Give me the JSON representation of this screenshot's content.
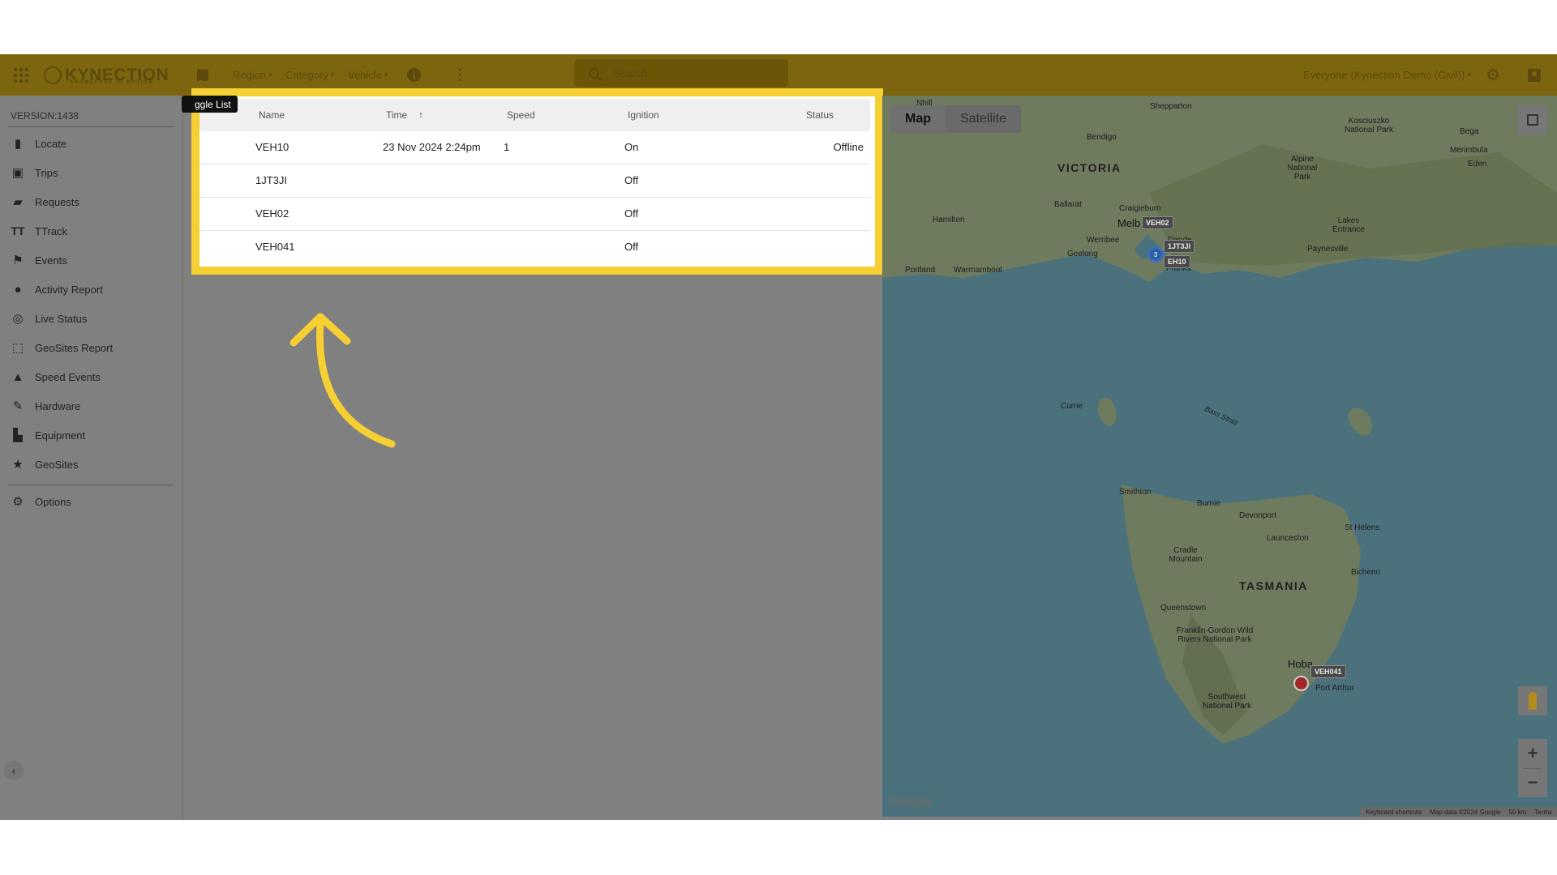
{
  "header": {
    "logo": "KYNECTION",
    "logo_tagline": "KNOWLEDGE IN MOTION",
    "region_label": "Region",
    "category_label": "Category",
    "vehicle_label": "Vehicle",
    "search_placeholder": "Search",
    "account_label": "Everyone (Kynection Demo (Civil))"
  },
  "sidebar": {
    "version": "VERSION:1438",
    "items": [
      {
        "label": "Locate",
        "icon": "map-icon"
      },
      {
        "label": "Trips",
        "icon": "trips-icon"
      },
      {
        "label": "Requests",
        "icon": "requests-icon"
      },
      {
        "label": "TTrack",
        "icon": "ttrack-icon"
      },
      {
        "label": "Events",
        "icon": "events-icon"
      },
      {
        "label": "Activity Report",
        "icon": "person-pin-icon"
      },
      {
        "label": "Live Status",
        "icon": "check-circle-icon"
      },
      {
        "label": "GeoSites Report",
        "icon": "dashed-square-icon"
      },
      {
        "label": "Speed Events",
        "icon": "road-icon"
      },
      {
        "label": "Hardware",
        "icon": "wrench-icon"
      },
      {
        "label": "Equipment",
        "icon": "truck-icon"
      },
      {
        "label": "GeoSites",
        "icon": "star-icon"
      }
    ],
    "options_label": "Options"
  },
  "tooltip": "ggle List",
  "list": {
    "columns": [
      "Name",
      "Time",
      "Speed",
      "Ignition",
      "Status"
    ],
    "sort_indicator": "↑",
    "rows": [
      {
        "name": "VEH10",
        "time": "23 Nov 2024 2:24pm",
        "speed": "1",
        "ignition": "On",
        "status": "Offline"
      },
      {
        "name": "1JT3JI",
        "time": "",
        "speed": "",
        "ignition": "Off",
        "status": ""
      },
      {
        "name": "VEH02",
        "time": "",
        "speed": "",
        "ignition": "Off",
        "status": ""
      },
      {
        "name": "VEH041",
        "time": "",
        "speed": "",
        "ignition": "Off",
        "status": ""
      }
    ]
  },
  "map": {
    "map_button": "Map",
    "satellite_button": "Satellite",
    "google": "Google",
    "attribution": {
      "shortcuts": "Keyboard shortcuts",
      "data": "Map data ©2024 Google",
      "scale": "50 km",
      "terms": "Terms"
    },
    "cluster_count": "3",
    "labels": {
      "victoria": "VICTORIA",
      "tasmania": "TASMANIA",
      "melbourne": "Melb",
      "hobart": "Hoba"
    },
    "places": [
      "Nhill",
      "Shepparton",
      "Kosciuszko National Park",
      "Bega",
      "Merimbula",
      "Eden",
      "Bendigo",
      "Alpine National Park",
      "Ballarat",
      "Craigieburn",
      "Hamilton",
      "Lakes Entrance",
      "Werribee",
      "Dande",
      "Paynesville",
      "Geelong",
      "Franks",
      "Portland",
      "Warrnambool",
      "Currie",
      "Bass Strait",
      "Smithton",
      "Burnie",
      "Devonport",
      "St Helens",
      "Launceston",
      "Cradle Mountain",
      "Bicheno",
      "Queenstown",
      "Franklin-Gordon Wild Rivers National Park",
      "Southwest National Park",
      "Port Arthur"
    ],
    "vehicles": [
      "VEH02",
      "1JT3JI",
      "EH10",
      "VEH041"
    ]
  }
}
